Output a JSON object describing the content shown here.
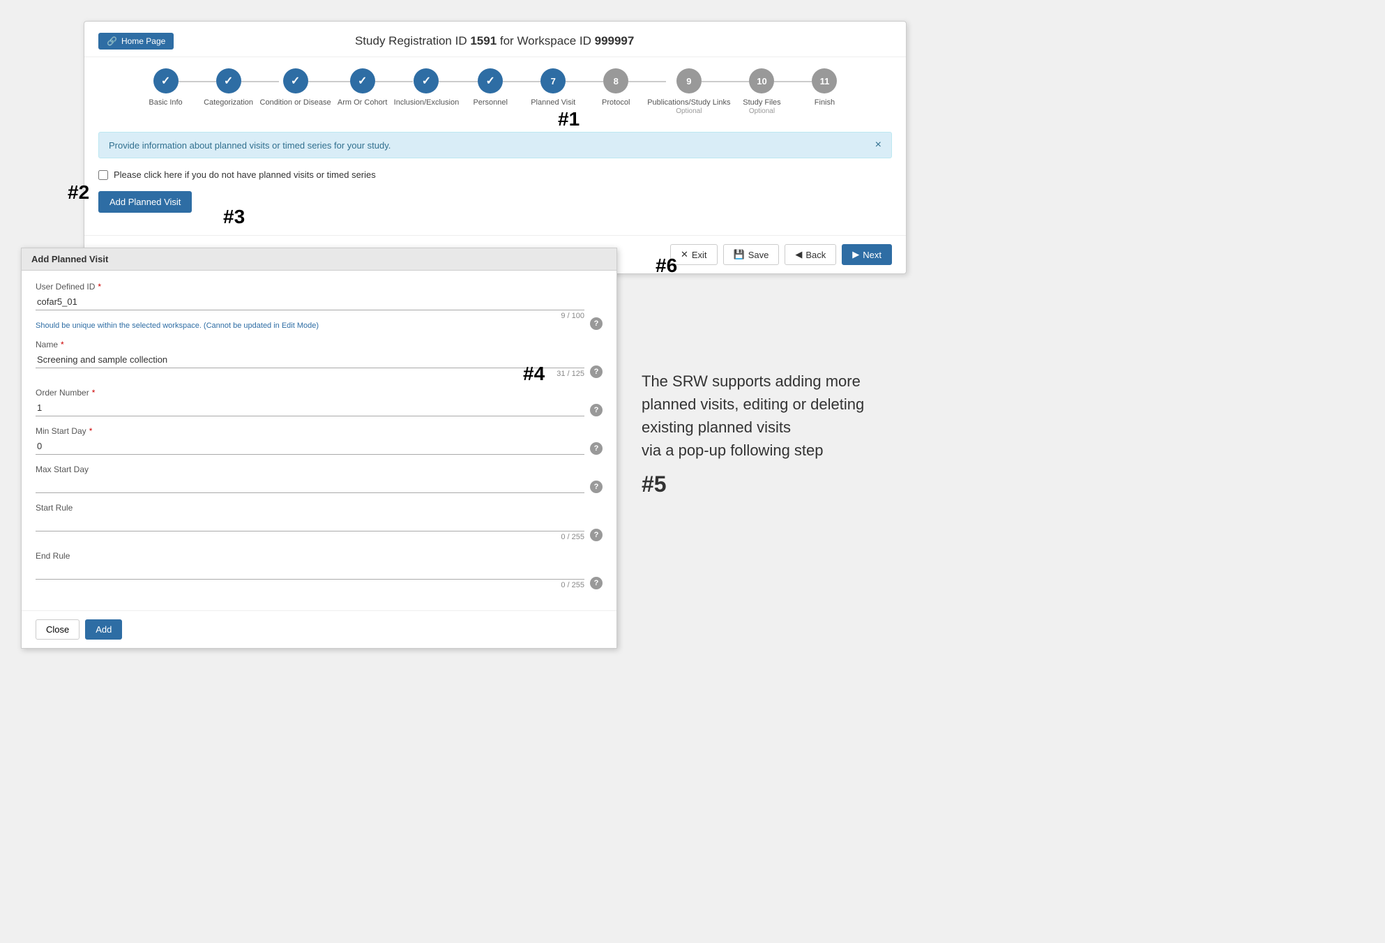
{
  "page": {
    "title_prefix": "Study Registration ID ",
    "study_id": "1591",
    "title_mid": " for Workspace ID ",
    "workspace_id": "999997"
  },
  "home_btn": {
    "label": "Home Page",
    "icon": "external-link-icon"
  },
  "steps": [
    {
      "number": "✓",
      "label": "Basic Info",
      "state": "completed"
    },
    {
      "number": "✓",
      "label": "Categorization",
      "state": "completed"
    },
    {
      "number": "✓",
      "label": "Condition or Disease",
      "state": "completed"
    },
    {
      "number": "✓",
      "label": "Arm Or Cohort",
      "state": "completed"
    },
    {
      "number": "✓",
      "label": "Inclusion/Exclusion",
      "state": "completed"
    },
    {
      "number": "✓",
      "label": "Personnel",
      "state": "completed"
    },
    {
      "number": "7",
      "label": "Planned Visit",
      "state": "active"
    },
    {
      "number": "8",
      "label": "Protocol",
      "state": "inactive"
    },
    {
      "number": "9",
      "label": "Publications/Study Links",
      "sublabel": "Optional",
      "state": "inactive"
    },
    {
      "number": "10",
      "label": "Study Files",
      "sublabel": "Optional",
      "state": "inactive"
    },
    {
      "number": "11",
      "label": "Finish",
      "state": "inactive"
    }
  ],
  "info_banner": {
    "text": "Provide information about planned visits or timed series for your study.",
    "close_label": "×"
  },
  "checkbox": {
    "label": "Please click here if you do not have planned visits or timed series"
  },
  "add_visit_btn": {
    "label": "Add Planned Visit"
  },
  "footer_buttons": {
    "exit": "✕ Exit",
    "save": "💾 Save",
    "back": "◀ Back",
    "next": "▶ Next"
  },
  "popup": {
    "title": "Add Planned Visit",
    "fields": [
      {
        "id": "user_defined_id",
        "label": "User Defined ID",
        "required": true,
        "value": "cofar5_01",
        "hint": "Should be unique within the selected workspace. (Cannot be updated in Edit Mode)",
        "char_count": "9 / 100",
        "has_char_count": true,
        "has_hint": true
      },
      {
        "id": "name",
        "label": "Name",
        "required": true,
        "value": "Screening and sample collection",
        "char_count": "31 / 125",
        "has_char_count": true,
        "has_hint": false
      },
      {
        "id": "order_number",
        "label": "Order Number",
        "required": true,
        "value": "1",
        "has_char_count": false,
        "has_hint": false
      },
      {
        "id": "min_start_day",
        "label": "Min Start Day",
        "required": true,
        "value": "0",
        "has_char_count": false,
        "has_hint": false
      },
      {
        "id": "max_start_day",
        "label": "Max Start Day",
        "required": false,
        "value": "",
        "has_char_count": false,
        "has_hint": false
      },
      {
        "id": "start_rule",
        "label": "Start Rule",
        "required": false,
        "value": "",
        "char_count": "0 / 255",
        "has_char_count": true,
        "has_hint": false
      },
      {
        "id": "end_rule",
        "label": "End Rule",
        "required": false,
        "value": "",
        "char_count": "0 / 255",
        "has_char_count": true,
        "has_hint": false
      }
    ],
    "close_btn": "Close",
    "add_btn": "Add"
  },
  "annotations": {
    "a1": "#1",
    "a2": "#2",
    "a3": "#3",
    "a4": "#4",
    "a5": "#5",
    "a6": "#6"
  },
  "sidebar": {
    "text": "The SRW supports adding more planned visits, editing or deleting existing planned visits",
    "text2": "via a pop-up following step"
  }
}
